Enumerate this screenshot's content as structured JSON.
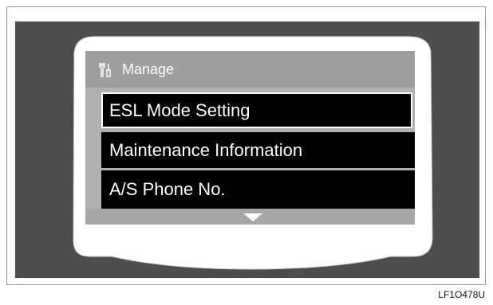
{
  "header": {
    "title": "Manage",
    "icon": "tools-icon"
  },
  "menu": {
    "items": [
      {
        "label": "ESL Mode Setting",
        "selected": true
      },
      {
        "label": "Maintenance Information",
        "selected": false
      },
      {
        "label": "A/S Phone No.",
        "selected": false
      }
    ],
    "scroll_indicator": "down-arrow-icon"
  },
  "figure_code": "LF1O478U",
  "colors": {
    "background_dark": "#4d4d4d",
    "bezel": "#ffffff",
    "header_bg": "#9e9e9e",
    "item_bg": "#000000",
    "item_text": "#ffffff"
  }
}
